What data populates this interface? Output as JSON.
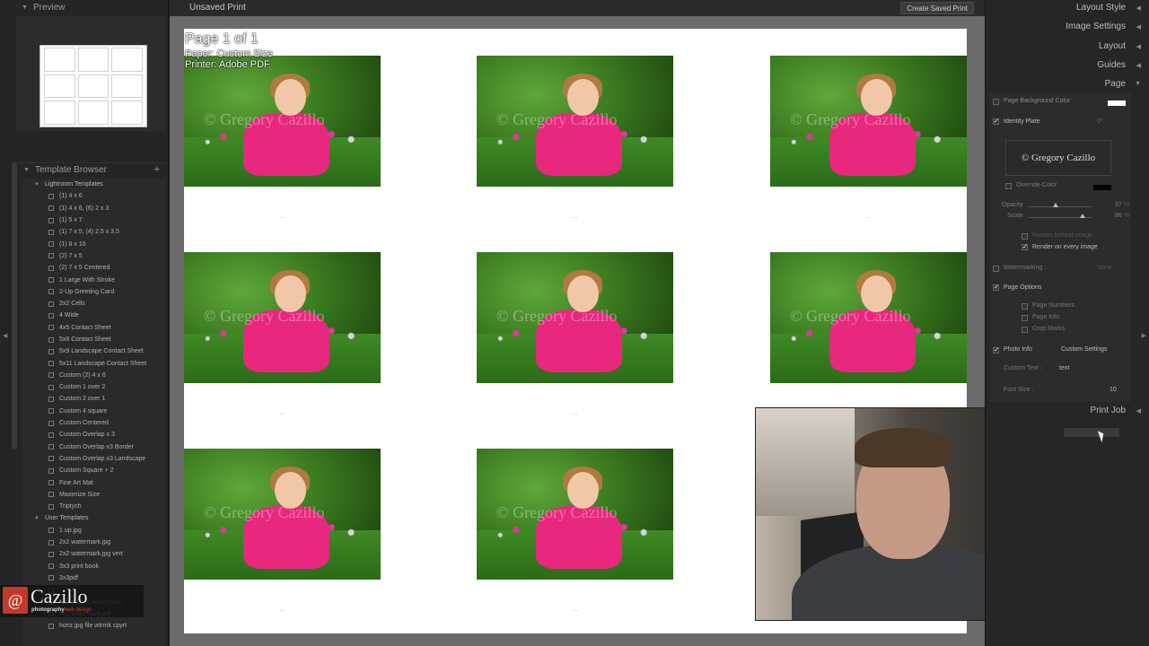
{
  "left_panel": {
    "preview_label": "Preview",
    "template_browser_label": "Template Browser",
    "folders": [
      {
        "name": "Lightroom Templates",
        "items": [
          "(1) 4 x 6",
          "(1) 4 x 6, (6) 2 x 3",
          "(1) 5 x 7",
          "(1) 7 x 5, (4) 2.5 x 3.5",
          "(1) 8 x 10",
          "(2) 7 x 5",
          "(2) 7 x 5 Centered",
          "1 Large With Stroke",
          "2-Up Greeting Card",
          "2x2 Cells",
          "4 Wide",
          "4x5 Contact Sheet",
          "5x8 Contact Sheet",
          "5x9 Landscape Contact Sheet",
          "5x11 Landscape Contact Sheet",
          "Custom (2) 4 x 6",
          "Custom 1 over 2",
          "Custom 2 over 1",
          "Custom 4 square",
          "Custom Centered",
          "Custom Overlap x 3",
          "Custom Overlap x3 Border",
          "Custom Overlap x3 Landscape",
          "Custom Square + 2",
          "Fine Art Mat",
          "Maximize Size",
          "Triptych"
        ]
      },
      {
        "name": "User Templates",
        "items": [
          "1 up.jpg",
          "2x2 watermark.jpg",
          "2x2 watermark.jpg vert",
          "3x3 print book",
          "3x3pdf",
          "",
          "4x5 grid no watermark",
          "5x2 watermark.pdf",
          "horiz.jpg file wtrmk cpyrt"
        ]
      }
    ]
  },
  "logo": {
    "name": "Cazillo",
    "sub_prefix": "photography",
    "sub_suffix": "web design"
  },
  "center": {
    "title": "Unsaved Print",
    "save_button": "Create Saved Print",
    "page_title": "Page 1 of 1",
    "paper": "Paper: Custom Size",
    "printer": "Printer: Adobe PDF",
    "watermark": "© Gregory Cazillo",
    "caption": "..."
  },
  "right_panel": {
    "sections": [
      "Layout Style",
      "Image Settings",
      "Layout",
      "Guides",
      "Page"
    ],
    "page_bg_color": "Page Background Color",
    "identity_plate": "Identity Plate",
    "identity_angle": "0°",
    "plate_text": "© Gregory Cazillo",
    "override_color": "Override Color",
    "opacity_label": "Opacity",
    "opacity_value": "37",
    "scale_label": "Scale",
    "scale_value": "86",
    "render_behind": "Render behind image",
    "render_every": "Render on every image",
    "watermarking": "Watermarking :",
    "watermarking_value": "None",
    "page_options": "Page Options",
    "page_numbers": "Page Numbers",
    "page_info": "Page Info",
    "crop_marks": "Crop Marks",
    "photo_info": "Photo Info",
    "photo_info_value": "Custom Settings",
    "custom_text_label": "Custom Text :",
    "custom_text_value": "text",
    "font_size_label": "Font Size :",
    "font_size_value": "10",
    "print_job": "Print Job",
    "percent": "%"
  },
  "colors": {
    "accent_pink": "#e8277f",
    "panel_bg": "#262626",
    "page_white": "#ffffff"
  }
}
